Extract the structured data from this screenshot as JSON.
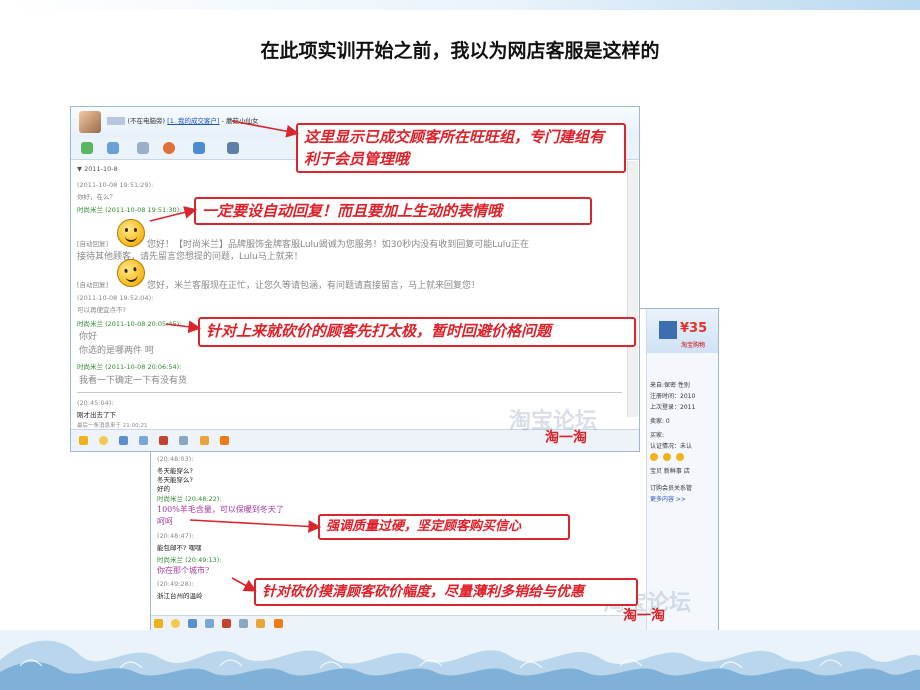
{
  "slide": {
    "title": "在此项实训开始之前，我以为网店客服是这样的"
  },
  "window1": {
    "header_status": "(不在电脑旁)",
    "header_group": "[1. 我的成交客户]",
    "header_tail": "- 蘑菇小仙女",
    "date": "▼ 2011-10-8",
    "messages": [
      {
        "name": "(2011-10-08 19:51:29):",
        "style": "g"
      },
      {
        "name": "你好，在么？",
        "style": "g"
      },
      {
        "name": "时尚米兰 (2011-10-08 19:51:30):",
        "style": "gr"
      },
      {
        "name": "[自动回复]",
        "style": "g"
      },
      {
        "name": "您好！【时尚米兰】品牌服饰金牌客服Lulu竭诚为您服务！如30秒内没有收到回复可能Lulu正在",
        "style": "g"
      },
      {
        "name": "接待其他顾客，请先留言您想提的问题，Lulu马上就来！",
        "style": "g"
      },
      {
        "name": "[自动回复]",
        "style": "g"
      },
      {
        "name": "您好，米兰客服现在正忙，让您久等请包涵，有问题请直接留言，马上就来回复您！",
        "style": "g"
      },
      {
        "name": "(2011-10-08 19:52:04):",
        "style": "g"
      },
      {
        "name": "可以再便宜点不?",
        "style": "g"
      },
      {
        "name": "时尚米兰 (2011-10-08 20:05:45):",
        "style": "gr"
      },
      {
        "name": "你好",
        "style": "g"
      },
      {
        "name": "你选的是哪两件  呵",
        "style": "g"
      },
      {
        "name": "时尚米兰 (2011-10-08 20:06:54):",
        "style": "gr"
      },
      {
        "name": "我看一下确定一下有没有货",
        "style": "g"
      },
      {
        "name": "(20:45:04):",
        "style": "g"
      },
      {
        "name": "刚才出去了下",
        "style": "bk"
      },
      {
        "name": "最后一条消息来于 21:00:21",
        "style": "g"
      }
    ],
    "watermark": "淘宝论坛",
    "stamp": "淘一淘"
  },
  "window2": {
    "messages": [
      {
        "name": "(20:48:03):",
        "style": "g"
      },
      {
        "name": "冬天能穿么?",
        "style": "bk"
      },
      {
        "name": "冬天能穿么?",
        "style": "bk"
      },
      {
        "name": "好的",
        "style": "bk"
      },
      {
        "name": "时尚米兰 (20:48:22):",
        "style": "gr"
      },
      {
        "name": "100%羊毛含量，可以保暖到冬天了",
        "style": "pu"
      },
      {
        "name": "呵呵",
        "style": "pu"
      },
      {
        "name": "(20:48:47):",
        "style": "g"
      },
      {
        "name": "能包邮不? 嘿嘿",
        "style": "bk"
      },
      {
        "name": "时尚米兰 (20:49:13):",
        "style": "gr"
      },
      {
        "name": "你在那个城市?",
        "style": "pu"
      },
      {
        "name": "(20:49:28):",
        "style": "g"
      },
      {
        "name": "浙江台州的温岭",
        "style": "bk"
      }
    ],
    "side": {
      "price": "¥35",
      "tag": "淘宝购物",
      "rows": [
        "来自:保密  性别",
        "注册时间：2010",
        "上次登录：2011",
        "卖家: 0",
        "买家:",
        "认证情况：未认",
        "宝贝  新鲜事  店",
        "订购会员关系管",
        "更多内容 >>"
      ]
    },
    "watermark": "淘宝论坛",
    "stamp": "淘一淘"
  },
  "callouts": {
    "c1": "这里显示已成交顾客所在旺旺组，专门建组有利于会员管理哦",
    "c2": "一定要设自动回复！而且要加上生动的表情哦",
    "c3": "针对上来就砍价的顾客先打太极，暂时回避价格问题",
    "c4": "强调质量过硬，坚定顾客购买信心",
    "c5": "针对砍价摸清顾客砍价幅度，尽量薄利多销给与优惠"
  },
  "colors": {
    "callout_red": "#e0212a",
    "window_border": "#9fb8cf"
  }
}
